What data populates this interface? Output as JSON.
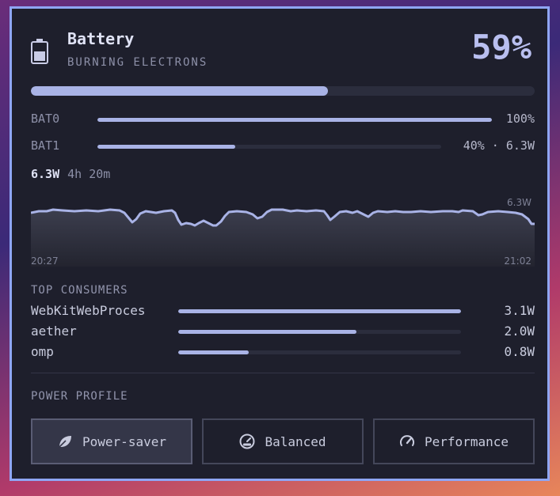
{
  "header": {
    "icon": "battery-icon",
    "title": "Battery",
    "subtitle": "BURNING ELECTRONS",
    "percent": "59%",
    "level": 0.59
  },
  "batteries": [
    {
      "name": "BAT0",
      "level": 1.0,
      "value": "100%"
    },
    {
      "name": "BAT1",
      "level": 0.4,
      "value": "40% · 6.3W"
    }
  ],
  "stats": {
    "power": "6.3W",
    "remaining": "4h 20m"
  },
  "graph": {
    "start_time": "20:27",
    "end_time": "21:02",
    "latest_label": "6.3W"
  },
  "consumers_title": "TOP CONSUMERS",
  "consumers": [
    {
      "name": "WebKitWebProces",
      "value": "3.1W",
      "level": 1.0
    },
    {
      "name": "aether",
      "value": "2.0W",
      "level": 0.63
    },
    {
      "name": "omp",
      "value": "0.8W",
      "level": 0.25
    }
  ],
  "profile_title": "POWER PROFILE",
  "profiles": [
    {
      "label": "Power-saver",
      "icon": "leaf-icon",
      "active": true
    },
    {
      "label": "Balanced",
      "icon": "gauge-icon",
      "active": false
    },
    {
      "label": "Performance",
      "icon": "speedometer-icon",
      "active": false
    }
  ],
  "colors": {
    "accent": "#a9b3e6",
    "border": "#8fa6f5",
    "panel": "#1e1f2c"
  }
}
